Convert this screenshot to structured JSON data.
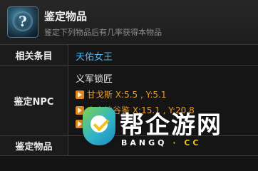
{
  "header": {
    "title": "鉴定物品",
    "subtitle": "鉴定下列物品后有几率获得本物品",
    "icon": "question-mark-orb-icon"
  },
  "table": {
    "related_label": "相关条目",
    "related_value": "天佑女王",
    "npc_label": "鉴定NPC",
    "npc_name": "义军锁匠",
    "locations": [
      "甘戈斯 X:5.5 , Y:5.1",
      "来之地谷鉴 X:15.1 , Y:20.8",
      ""
    ],
    "item_label": "鉴定物品"
  },
  "watermark": {
    "text": "帮企游网",
    "domain_left": "BANGQ",
    "domain_sep": "·",
    "domain_right": "CC"
  },
  "colors": {
    "link": "#4fb3e8",
    "location": "#e89c2a",
    "background": "#141414"
  }
}
